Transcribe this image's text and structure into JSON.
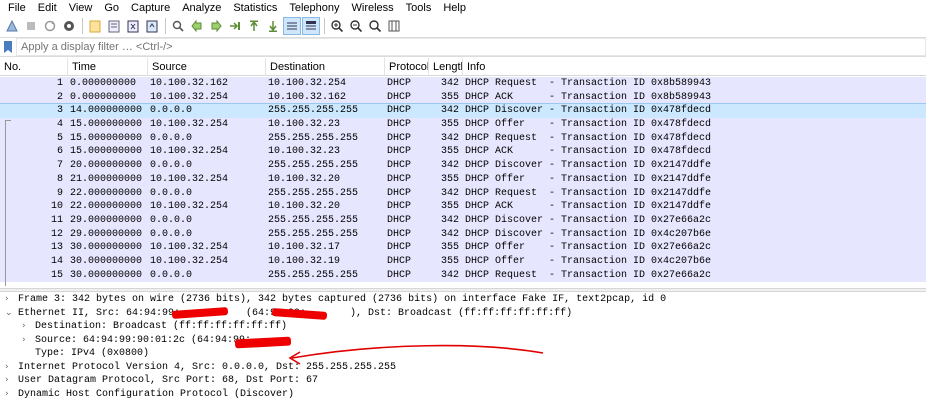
{
  "menubar": {
    "items": [
      "File",
      "Edit",
      "View",
      "Go",
      "Capture",
      "Analyze",
      "Statistics",
      "Telephony",
      "Wireless",
      "Tools",
      "Help"
    ]
  },
  "toolbar": {
    "icons": [
      "shark-fin-icon",
      "stop-icon",
      "restart-icon",
      "options-gear-icon",
      "open-file-icon",
      "save-file-icon",
      "close-file-icon",
      "reload-icon",
      "find-packet-icon",
      "go-back-icon",
      "go-forward-icon",
      "go-to-packet-icon",
      "go-first-icon",
      "go-last-icon",
      "autoscroll-icon",
      "colorize-icon",
      "zoom-in-icon",
      "zoom-out-icon",
      "normal-size-icon",
      "resize-columns-icon"
    ]
  },
  "filter": {
    "placeholder": "Apply a display filter … <Ctrl-/>"
  },
  "packet_list": {
    "columns": {
      "no": "No.",
      "time": "Time",
      "source": "Source",
      "destination": "Destination",
      "protocol": "Protocol",
      "length": "Length",
      "info": "Info"
    },
    "rows": [
      {
        "no": "1",
        "time": "0.000000000",
        "source": "10.100.32.162",
        "destination": "10.100.32.254",
        "protocol": "DHCP",
        "length": "342",
        "info": "DHCP Request  - Transaction ID 0x8b589943"
      },
      {
        "no": "2",
        "time": "0.000000000",
        "source": "10.100.32.254",
        "destination": "10.100.32.162",
        "protocol": "DHCP",
        "length": "355",
        "info": "DHCP ACK      - Transaction ID 0x8b589943"
      },
      {
        "no": "3",
        "time": "14.000000000",
        "source": "0.0.0.0",
        "destination": "255.255.255.255",
        "protocol": "DHCP",
        "length": "342",
        "info": "DHCP Discover - Transaction ID 0x478fdecd"
      },
      {
        "no": "4",
        "time": "15.000000000",
        "source": "10.100.32.254",
        "destination": "10.100.32.23",
        "protocol": "DHCP",
        "length": "355",
        "info": "DHCP Offer    - Transaction ID 0x478fdecd"
      },
      {
        "no": "5",
        "time": "15.000000000",
        "source": "0.0.0.0",
        "destination": "255.255.255.255",
        "protocol": "DHCP",
        "length": "342",
        "info": "DHCP Request  - Transaction ID 0x478fdecd"
      },
      {
        "no": "6",
        "time": "15.000000000",
        "source": "10.100.32.254",
        "destination": "10.100.32.23",
        "protocol": "DHCP",
        "length": "355",
        "info": "DHCP ACK      - Transaction ID 0x478fdecd"
      },
      {
        "no": "7",
        "time": "20.000000000",
        "source": "0.0.0.0",
        "destination": "255.255.255.255",
        "protocol": "DHCP",
        "length": "342",
        "info": "DHCP Discover - Transaction ID 0x2147ddfe"
      },
      {
        "no": "8",
        "time": "21.000000000",
        "source": "10.100.32.254",
        "destination": "10.100.32.20",
        "protocol": "DHCP",
        "length": "355",
        "info": "DHCP Offer    - Transaction ID 0x2147ddfe"
      },
      {
        "no": "9",
        "time": "22.000000000",
        "source": "0.0.0.0",
        "destination": "255.255.255.255",
        "protocol": "DHCP",
        "length": "342",
        "info": "DHCP Request  - Transaction ID 0x2147ddfe"
      },
      {
        "no": "10",
        "time": "22.000000000",
        "source": "10.100.32.254",
        "destination": "10.100.32.20",
        "protocol": "DHCP",
        "length": "355",
        "info": "DHCP ACK      - Transaction ID 0x2147ddfe"
      },
      {
        "no": "11",
        "time": "29.000000000",
        "source": "0.0.0.0",
        "destination": "255.255.255.255",
        "protocol": "DHCP",
        "length": "342",
        "info": "DHCP Discover - Transaction ID 0x27e66a2c"
      },
      {
        "no": "12",
        "time": "29.000000000",
        "source": "0.0.0.0",
        "destination": "255.255.255.255",
        "protocol": "DHCP",
        "length": "342",
        "info": "DHCP Discover - Transaction ID 0x4c207b6e"
      },
      {
        "no": "13",
        "time": "30.000000000",
        "source": "10.100.32.254",
        "destination": "10.100.32.17",
        "protocol": "DHCP",
        "length": "355",
        "info": "DHCP Offer    - Transaction ID 0x27e66a2c"
      },
      {
        "no": "14",
        "time": "30.000000000",
        "source": "10.100.32.254",
        "destination": "10.100.32.19",
        "protocol": "DHCP",
        "length": "355",
        "info": "DHCP Offer    - Transaction ID 0x4c207b6e"
      },
      {
        "no": "15",
        "time": "30.000000000",
        "source": "0.0.0.0",
        "destination": "255.255.255.255",
        "protocol": "DHCP",
        "length": "342",
        "info": "DHCP Request  - Transaction ID 0x27e66a2c"
      }
    ],
    "selected_row": "3"
  },
  "details": {
    "frame": "Frame 3: 342 bytes on wire (2736 bits), 342 bytes captured (2736 bits) on interface Fake IF, text2pcap, id 0",
    "ethernet_pre": "Ethernet II, Src: 64:94:99:",
    "ethernet_mid": " (64:94:99:",
    "ethernet_post": "), Dst: Broadcast (ff:ff:ff:ff:ff:ff)",
    "destination": "Destination: Broadcast (ff:ff:ff:ff:ff:ff)",
    "source_pre": "Source: 64:94:99:90:01:2c (64:94:99:",
    "type": "Type: IPv4 (0x0800)",
    "ip": "Internet Protocol Version 4, Src: 0.0.0.0, Dst: 255.255.255.255",
    "udp": "User Datagram Protocol, Src Port: 68, Dst Port: 67",
    "dhcp": "Dynamic Host Configuration Protocol (Discover)"
  },
  "colors": {
    "row_bg": "#e7e6ff",
    "selected_bg": "#cce8ff",
    "annotation_red": "#e00000"
  }
}
